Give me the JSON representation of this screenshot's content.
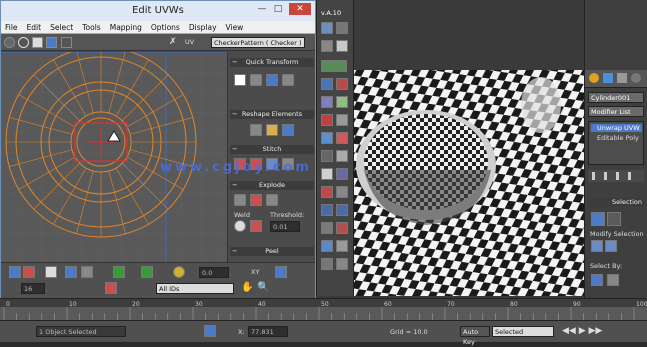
{
  "uv_window": {
    "title": "Edit UVWs",
    "menus": [
      "File",
      "Edit",
      "Select",
      "Tools",
      "Mapping",
      "Options",
      "Display",
      "View"
    ],
    "texture_dropdown": "CheckerPattern ( Checker )",
    "uv_label": "UV",
    "sections": {
      "quick_transform": "Quick Transform",
      "reshape": "Reshape Elements",
      "stitch": "Stitch",
      "explode": "Explode",
      "weld": "Weld",
      "threshold": "Threshold:",
      "threshold_value": "0.01",
      "peel": "Peel"
    },
    "bottom": {
      "spinner_value": "0.0",
      "axis_label": "XY",
      "spinner2": "16",
      "element_dd": "All IDs"
    }
  },
  "midstrip": {
    "version": "v.A.10"
  },
  "command_panel": {
    "object_name": "Cylinder001",
    "modifier_list": "Modifier List",
    "stack": [
      "Unwrap UVW",
      "Editable Poly"
    ],
    "selection_header": "Selection",
    "modify_selection": "Modify Selection",
    "select_by": "Select By:"
  },
  "timeline": {
    "ticks": [
      "0",
      "10",
      "20",
      "30",
      "40",
      "50",
      "60",
      "70",
      "80",
      "90",
      "100"
    ]
  },
  "status": {
    "selection_text": "1 Object Selected",
    "x_value": "77.831",
    "grid_value": "Grid = 10.0",
    "auto_key": "Auto Key",
    "key_mode": "Selected"
  },
  "watermark": "www.cgjoy.com"
}
